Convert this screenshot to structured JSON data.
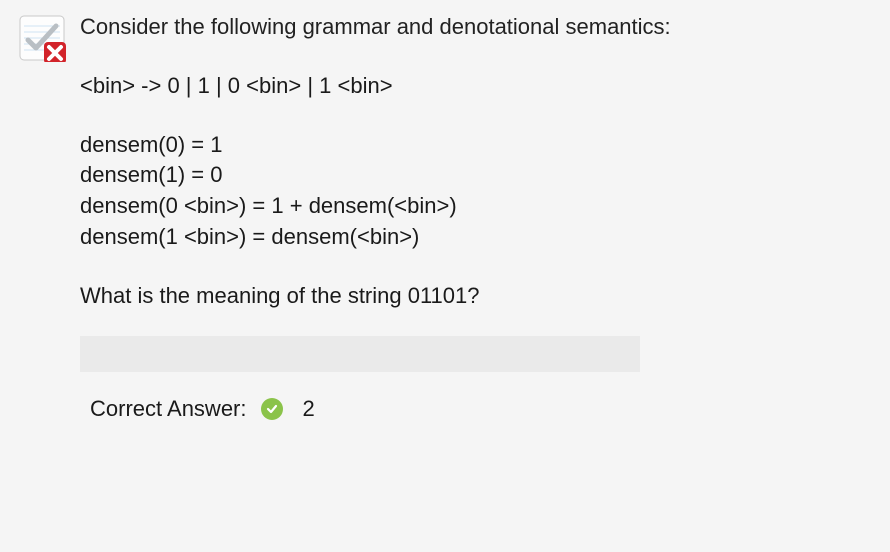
{
  "question": {
    "intro": "Consider the following grammar and denotational semantics:",
    "grammar": "<bin> -> 0 | 1 | 0 <bin> | 1 <bin>",
    "semantics": [
      "densem(0) = 1",
      "densem(1) = 0",
      "densem(0 <bin>) = 1 + densem(<bin>)",
      "densem(1 <bin>) = densem(<bin>)"
    ],
    "prompt": "What is the meaning of the string 01101?",
    "user_answer": "",
    "status": "incorrect"
  },
  "feedback": {
    "correct_label": "Correct Answer:",
    "correct_value": "2"
  }
}
